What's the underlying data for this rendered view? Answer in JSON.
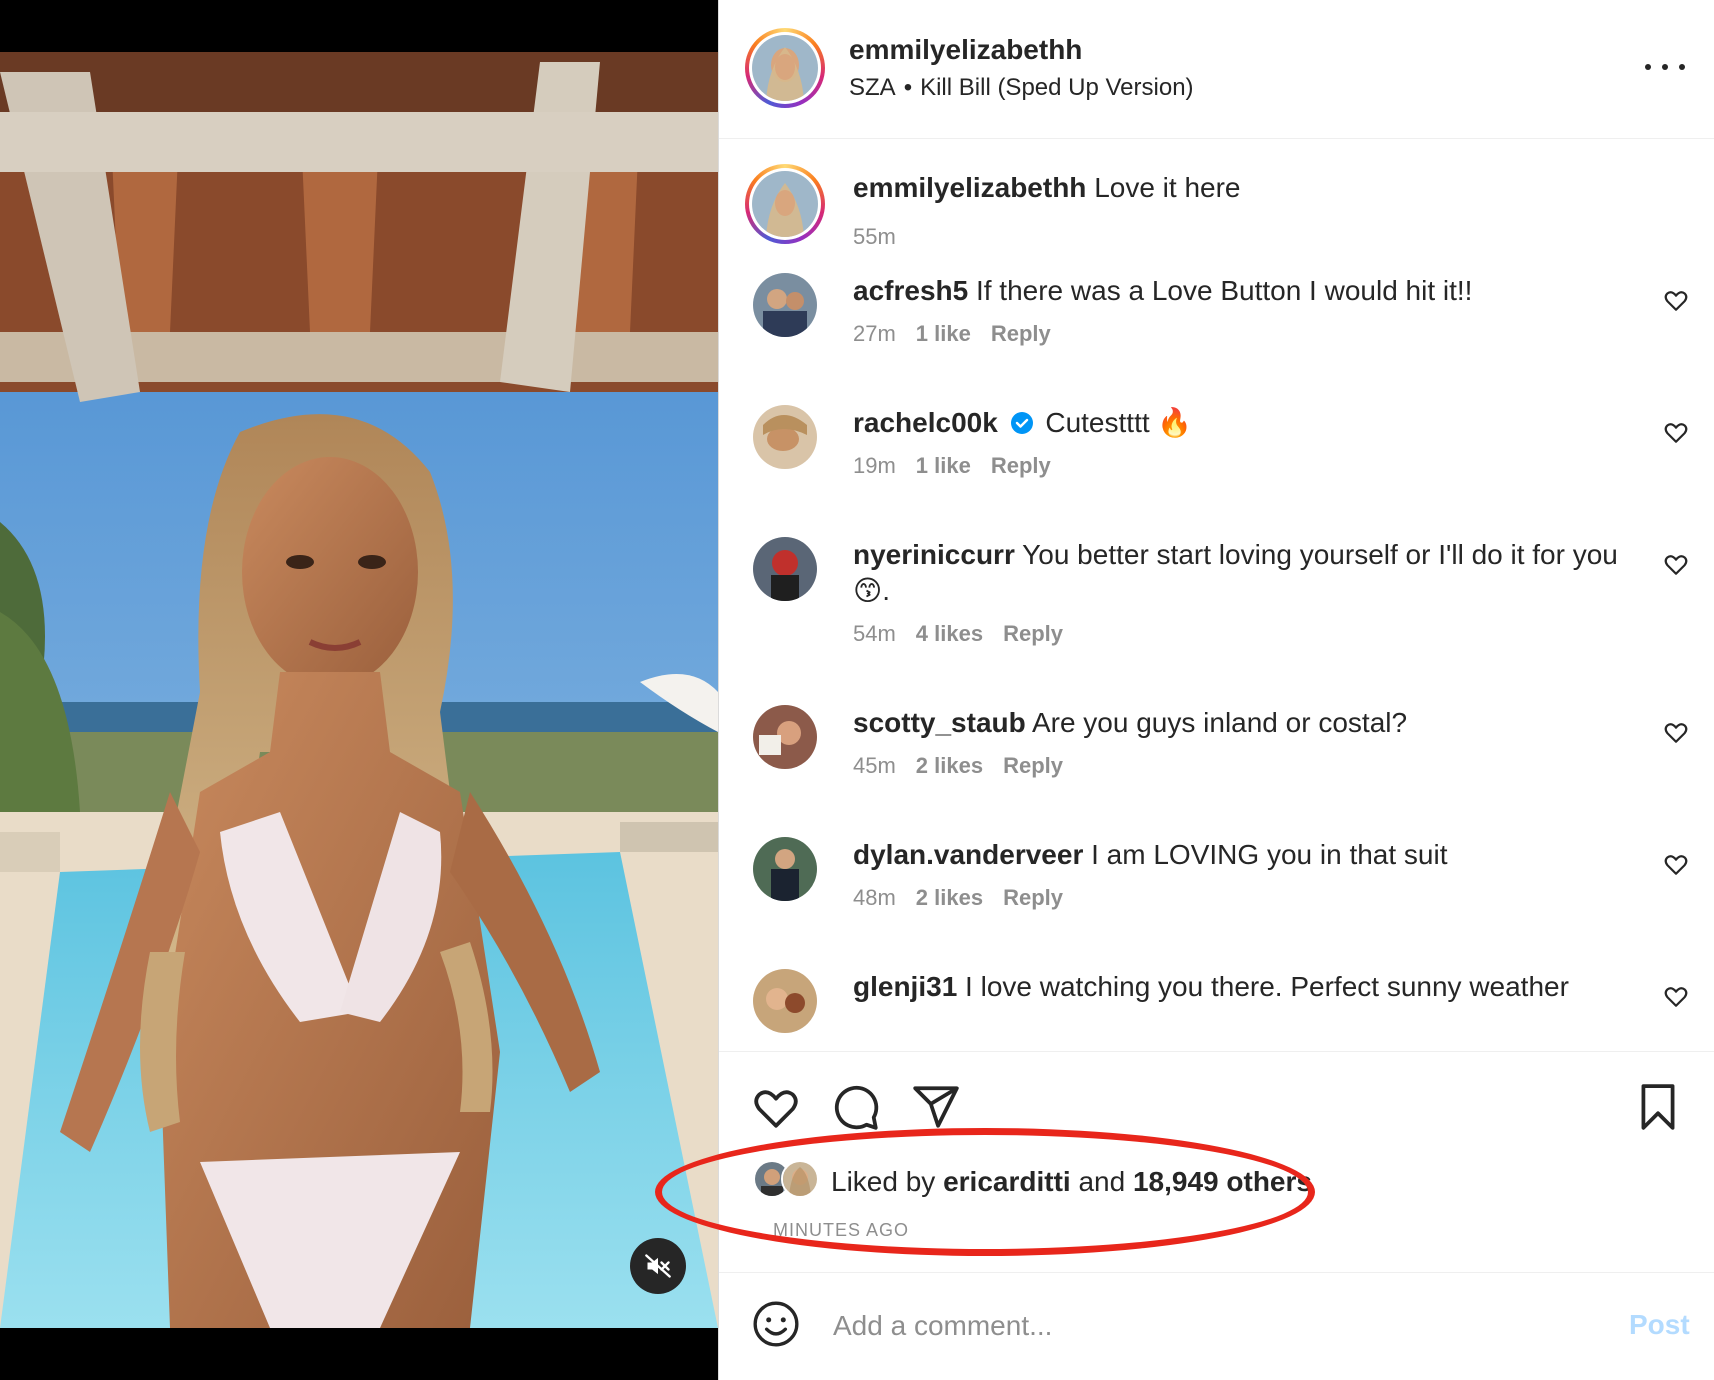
{
  "post": {
    "username": "emmilyelizabethh",
    "audio_artist": "SZA",
    "audio_separator": "•",
    "audio_title": "Kill Bill (Sped Up Version)"
  },
  "caption": {
    "username": "emmilyelizabethh",
    "text": "Love it here",
    "time": "55m"
  },
  "comments": [
    {
      "username": "acfresh5",
      "text": "If there was a Love Button I would hit it!!",
      "time": "27m",
      "likes": "1 like",
      "reply": "Reply",
      "verified": false
    },
    {
      "username": "rachelc00k",
      "text": "Cutestttt 🔥",
      "time": "19m",
      "likes": "1 like",
      "reply": "Reply",
      "verified": true
    },
    {
      "username": "nyeriniccurr",
      "text": "You better start loving yourself or I'll do it for you😙.",
      "time": "54m",
      "likes": "4 likes",
      "reply": "Reply",
      "verified": false
    },
    {
      "username": "scotty_staub",
      "text": "Are you guys inland or costal?",
      "time": "45m",
      "likes": "2 likes",
      "reply": "Reply",
      "verified": false
    },
    {
      "username": "dylan.vanderveer",
      "text": "I am LOVING you in that suit",
      "time": "48m",
      "likes": "2 likes",
      "reply": "Reply",
      "verified": false
    },
    {
      "username": "glenji31",
      "text": "I love watching you there. Perfect sunny weather",
      "time": "",
      "likes": "",
      "reply": "",
      "verified": false
    }
  ],
  "likes": {
    "prefix": "Liked by",
    "user": "ericarditti",
    "middle": "and",
    "count": "18,949 others",
    "timestamp": "MINUTES AGO"
  },
  "comment_box": {
    "placeholder": "Add a comment...",
    "post_label": "Post"
  },
  "icons": {
    "more": "more-horizontal-icon",
    "like": "heart-icon",
    "comment": "comment-bubble-icon",
    "share": "paper-plane-icon",
    "save": "bookmark-icon",
    "emoji": "smiley-icon",
    "mute": "speaker-muted-icon",
    "verified": "verified-badge-icon"
  },
  "colors": {
    "accent_blue": "#0095f6",
    "post_disabled": "#b3dbff",
    "annotation_red": "#e8261b",
    "secondary_text": "#8e8e8e"
  }
}
